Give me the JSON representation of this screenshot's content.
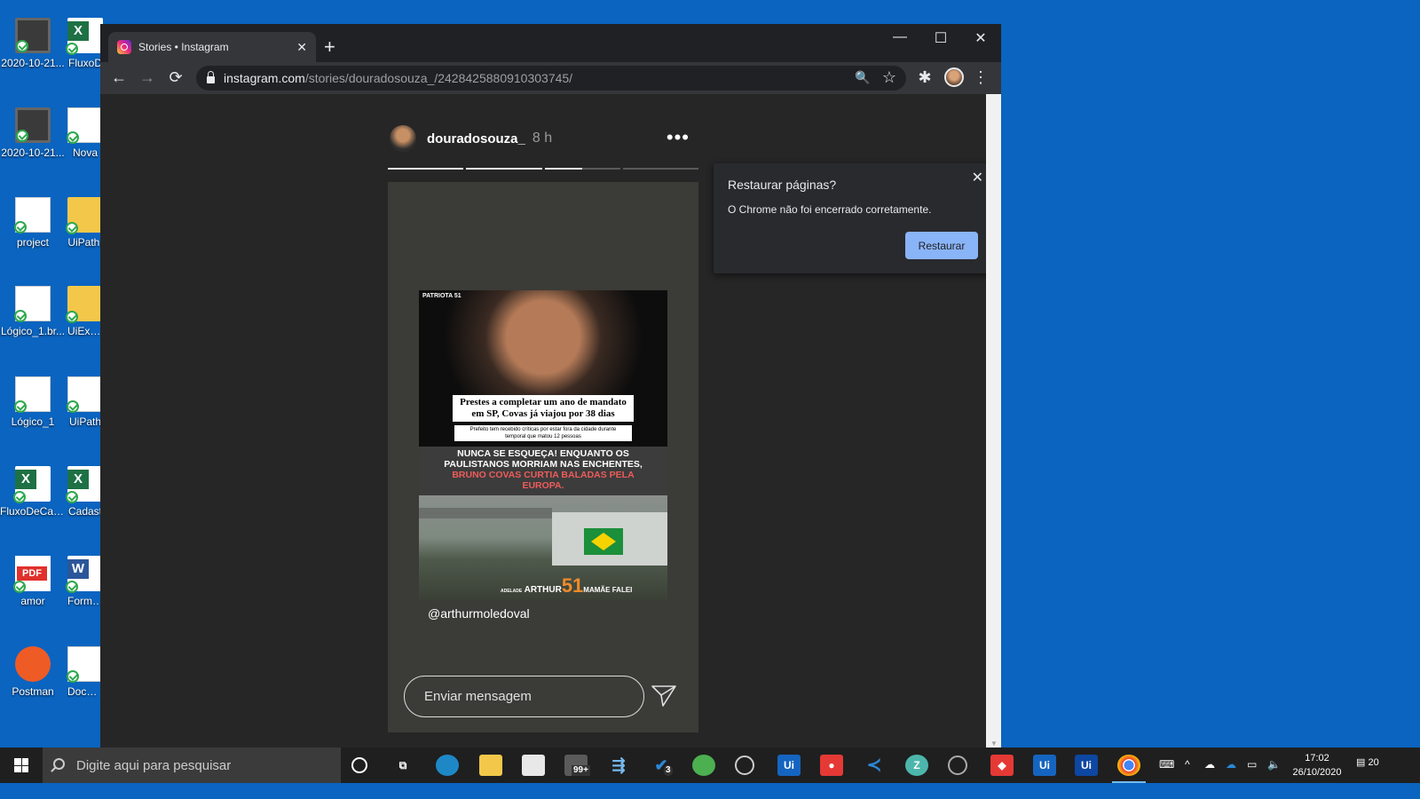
{
  "desktop": {
    "icons": [
      {
        "label": "2020-10-21...",
        "icon": "screenshot-icon"
      },
      {
        "label": "FluxoD",
        "icon": "excel-icon"
      },
      {
        "label": "2020-10-21...",
        "icon": "screenshot-icon"
      },
      {
        "label": "Nova",
        "icon": "document-icon"
      },
      {
        "label": "project",
        "icon": "visual-studio-project-icon"
      },
      {
        "label": "UiPath.",
        "icon": "folder-icon"
      },
      {
        "label": "Lógico_1.br...",
        "icon": "document-icon"
      },
      {
        "label": "UiExplo",
        "icon": "folder-icon"
      },
      {
        "label": "Lógico_1",
        "icon": "diagram-icon"
      },
      {
        "label": "UiPath",
        "icon": "uipath-icon"
      },
      {
        "label": "FluxoDeCaixa",
        "icon": "excel-icon"
      },
      {
        "label": "Cadast",
        "icon": "excel-icon"
      },
      {
        "label": "amor",
        "icon": "pdf-icon"
      },
      {
        "label": "Formu Entrevis",
        "icon": "word-icon"
      },
      {
        "label": "Postman",
        "icon": "postman-icon"
      },
      {
        "label": "Docum Estagi",
        "icon": "document-icon"
      }
    ]
  },
  "browser": {
    "tab_title": "Stories • Instagram",
    "tab_close": "✕",
    "new_tab": "+",
    "window_controls": {
      "minimize": "—",
      "maximize": "☐",
      "close": "✕"
    },
    "nav": {
      "back": "←",
      "forward": "→",
      "reload": "⟳"
    },
    "url_domain": "instagram.com",
    "url_path": "/stories/douradosouza_/2428425880910303745/",
    "toolbar_icons": {
      "zoom": "🔍",
      "bookmark": "☆",
      "extensions": "✱",
      "menu": "⋮"
    }
  },
  "story": {
    "username": "douradosouza_",
    "time": "8 h",
    "more": "•••",
    "progress": [
      1.0,
      1.0,
      0.5,
      0.0
    ],
    "post": {
      "brand": "PATRIOTA 51",
      "headline_line1": "Prestes a completar um ano de mandato",
      "headline_line2": "em SP, Covas já viajou por 38 dias",
      "sub_line1": "Prefeito tem recebido críticas por estar fora da cidade durante",
      "sub_line2": "temporal que matou 12 pessoas",
      "caption_white": "NUNCA SE ESQUEÇA! ENQUANTO OS PAULISTANOS MORRIAM NAS ENCHENTES,",
      "caption_red": "BRUNO COVAS CURTIA BALADAS PELA EUROPA.",
      "logo_name": "ARTHUR",
      "logo_number": "51",
      "logo_right": "MAMÃE FALEI",
      "logo_small": "ADELADE"
    },
    "mention": "@arthurmoledoval",
    "message_placeholder": "Enviar mensagem"
  },
  "restore_popup": {
    "title": "Restaurar páginas?",
    "message": "O Chrome não foi encerrado corretamente.",
    "button": "Restaurar",
    "close": "✕"
  },
  "taskbar": {
    "search_placeholder": "Digite aqui para pesquisar",
    "mail_badge": "99+",
    "todo_badge": "3",
    "time": "17:02",
    "date": "26/10/2020",
    "notifications": "20",
    "accent": "#76b9ed"
  }
}
